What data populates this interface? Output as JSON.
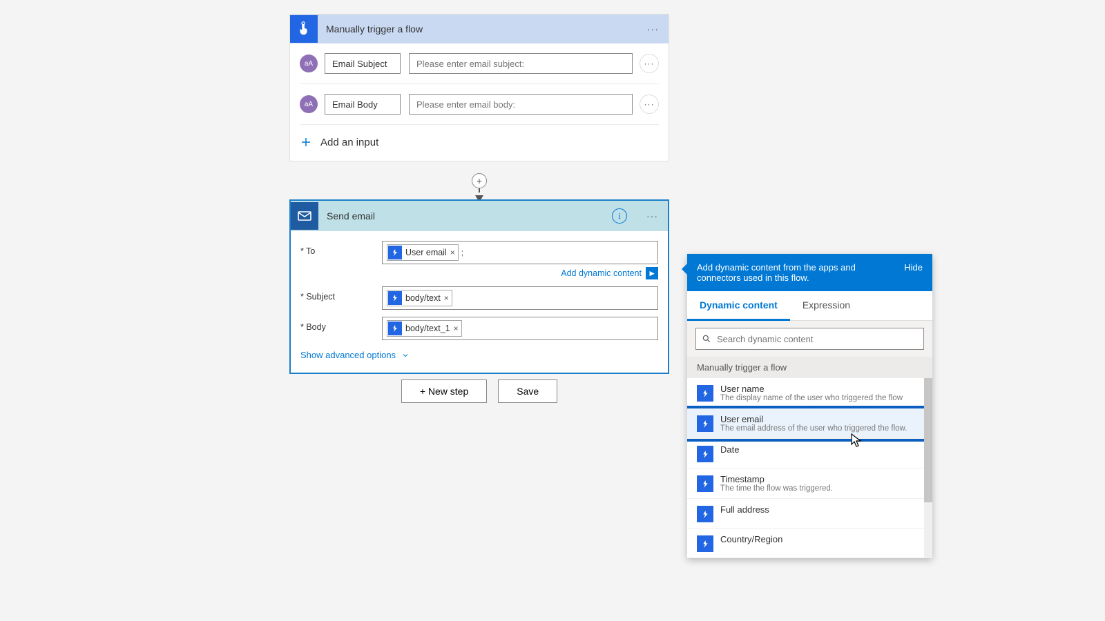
{
  "trigger": {
    "title": "Manually trigger a flow",
    "params": [
      {
        "label": "Email Subject",
        "placeholder": "Please enter email subject:"
      },
      {
        "label": "Email Body",
        "placeholder": "Please enter email body:"
      }
    ],
    "add_input": "Add an input"
  },
  "action": {
    "title": "Send email",
    "fields": {
      "to": {
        "label": "* To",
        "token": "User email",
        "suffix": ";"
      },
      "to_adc": "Add dynamic content",
      "subject": {
        "label": "* Subject",
        "token": "body/text"
      },
      "body": {
        "label": "* Body",
        "token": "body/text_1"
      }
    },
    "show_advanced": "Show advanced options"
  },
  "buttons": {
    "new_step": "+ New step",
    "save": "Save"
  },
  "dc_panel": {
    "banner": "Add dynamic content from the apps and connectors used in this flow.",
    "hide": "Hide",
    "tabs": {
      "dynamic": "Dynamic content",
      "expression": "Expression"
    },
    "search_placeholder": "Search dynamic content",
    "group": "Manually trigger a flow",
    "items": [
      {
        "title": "User name",
        "desc": "The display name of the user who triggered the flow"
      },
      {
        "title": "User email",
        "desc": "The email address of the user who triggered the flow."
      },
      {
        "title": "Date",
        "desc": ""
      },
      {
        "title": "Timestamp",
        "desc": "The time the flow was triggered."
      },
      {
        "title": "Full address",
        "desc": ""
      },
      {
        "title": "Country/Region",
        "desc": ""
      }
    ]
  },
  "param_badge": "aA"
}
